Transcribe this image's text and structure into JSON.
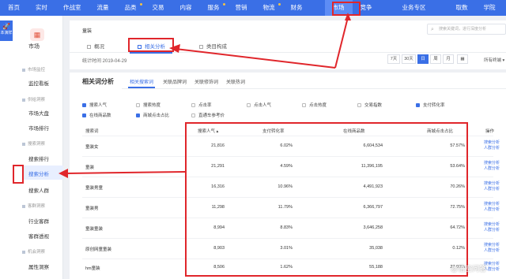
{
  "topnav": {
    "items": [
      {
        "label": "首页"
      },
      {
        "label": "实时"
      },
      {
        "label": "作战室"
      },
      {
        "label": "流量"
      },
      {
        "label": "品类"
      },
      {
        "label": "交易"
      },
      {
        "label": "内容"
      },
      {
        "label": "服务"
      },
      {
        "label": "营销"
      },
      {
        "label": "物流"
      },
      {
        "label": "财务"
      },
      {
        "label": "市场"
      },
      {
        "label": "竞争"
      },
      {
        "label": "业务专区"
      },
      {
        "label": "取数"
      },
      {
        "label": "学院"
      }
    ],
    "active": "市场"
  },
  "sidebar": {
    "logo_text": "本演样",
    "module": "市场",
    "sections": [
      {
        "title": "市场监控",
        "items": [
          "监控看板"
        ]
      },
      {
        "title": "供给洞察",
        "items": [
          "市场大盘",
          "市场排行"
        ]
      },
      {
        "title": "搜索洞察",
        "items": [
          "搜索排行",
          "搜索分析",
          "搜索人群"
        ]
      },
      {
        "title": "客群洞察",
        "items": [
          "行业客群",
          "客群透视"
        ]
      },
      {
        "title": "机会洞察",
        "items": [
          "属性洞察"
        ]
      }
    ],
    "active_item": "搜索分析"
  },
  "header_panel": {
    "breadcrumb": "童装",
    "search_placeholder": "搜索关键词，进行深度分析",
    "tabs": [
      "概况",
      "相关分析",
      "类目构成"
    ],
    "active_tab": "相关分析",
    "stat_time": "统计时间 2019-04-29",
    "periods": [
      "7天",
      "30天",
      "日",
      "周",
      "月"
    ],
    "active_period": "日",
    "all_channels": "所有终端"
  },
  "main": {
    "title": "相关词分析",
    "tabs": [
      "相关搜索词",
      "关联品牌词",
      "关联修饰词",
      "关联热词"
    ],
    "active_tab": "相关搜索词",
    "checkboxes": [
      {
        "label": "搜索人气",
        "checked": true
      },
      {
        "label": "搜索热度",
        "checked": false
      },
      {
        "label": "点击率",
        "checked": false
      },
      {
        "label": "点击人气",
        "checked": false
      },
      {
        "label": "点击热度",
        "checked": false
      },
      {
        "label": "交易指数",
        "checked": false
      },
      {
        "label": "支付转化率",
        "checked": true
      },
      {
        "label": "在线商品数",
        "checked": true
      },
      {
        "label": "商城点击占比",
        "checked": true
      },
      {
        "label": "直通车参考价",
        "checked": false
      }
    ],
    "table": {
      "headers": [
        "搜索词",
        "搜索人气",
        "支付转化率",
        "在线商品数",
        "商城点击占比",
        "操作"
      ],
      "rows": [
        {
          "keyword": "童装女",
          "popularity": "21,816",
          "conversion": "6.02%",
          "items": "6,604,534",
          "mall_ratio": "57.57%"
        },
        {
          "keyword": "童装",
          "popularity": "21,291",
          "conversion": "4.59%",
          "items": "11,396,195",
          "mall_ratio": "53.64%"
        },
        {
          "keyword": "童装男童",
          "popularity": "16,316",
          "conversion": "10.96%",
          "items": "4,491,923",
          "mall_ratio": "70.26%"
        },
        {
          "keyword": "童装男",
          "popularity": "11,298",
          "conversion": "11.79%",
          "items": "6,366,797",
          "mall_ratio": "72.75%"
        },
        {
          "keyword": "童装童装",
          "popularity": "8,994",
          "conversion": "8.83%",
          "items": "3,646,258",
          "mall_ratio": "64.72%"
        },
        {
          "keyword": "原创网童童装",
          "popularity": "8,903",
          "conversion": "3.01%",
          "items": "35,038",
          "mall_ratio": "0.12%"
        },
        {
          "keyword": "hm童装",
          "popularity": "8,506",
          "conversion": "1.62%",
          "items": "55,188",
          "mall_ratio": "27.00%"
        }
      ],
      "actions": [
        "搜索分析",
        "人群分析"
      ]
    }
  },
  "watermark": "@悟空问答",
  "colors": {
    "topbar": "#3a6fe6",
    "accent": "#3a6fe6",
    "highlight": "#e0262b"
  }
}
